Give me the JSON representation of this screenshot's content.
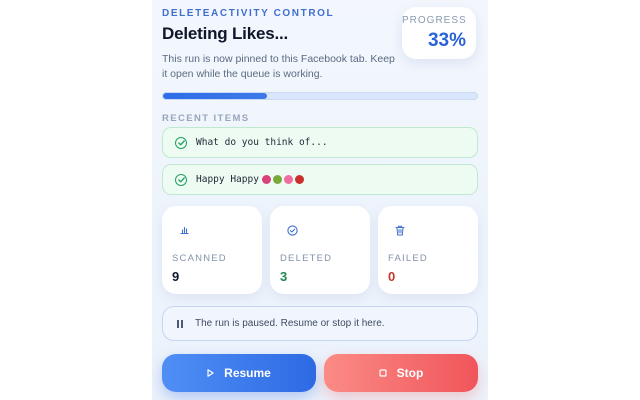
{
  "header": {
    "eyebrow": "DELETEACTIVITY CONTROL",
    "title": "Deleting Likes...",
    "subtitle": "This run is now pinned to this Facebook tab. Keep it open while the queue is working."
  },
  "progress": {
    "label": "PROGRESS",
    "value_text": "33%",
    "fraction": 0.33
  },
  "recent": {
    "label": "RECENT ITEMS",
    "items": [
      {
        "text": "What do you think of..."
      },
      {
        "text": "Happy Happy"
      }
    ],
    "emoji_colors": [
      "#d9417a",
      "#7aa93a",
      "#f06ba0",
      "#c9302c"
    ]
  },
  "stats": [
    {
      "label": "SCANNED",
      "value": "9",
      "icon": "bar-chart-icon",
      "color": "#0f172a"
    },
    {
      "label": "DELETED",
      "value": "3",
      "icon": "check-circle-icon",
      "color": "#1f8a4c"
    },
    {
      "label": "FAILED",
      "value": "0",
      "icon": "trash-icon",
      "color": "#c0392b"
    }
  ],
  "notice": {
    "text": "The run is paused. Resume or stop it here.",
    "icon": "pause-icon"
  },
  "actions": {
    "resume_label": "Resume",
    "stop_label": "Stop"
  },
  "colors": {
    "accent": "#2e6ee6",
    "success": "#22a060",
    "danger": "#f0555a"
  }
}
